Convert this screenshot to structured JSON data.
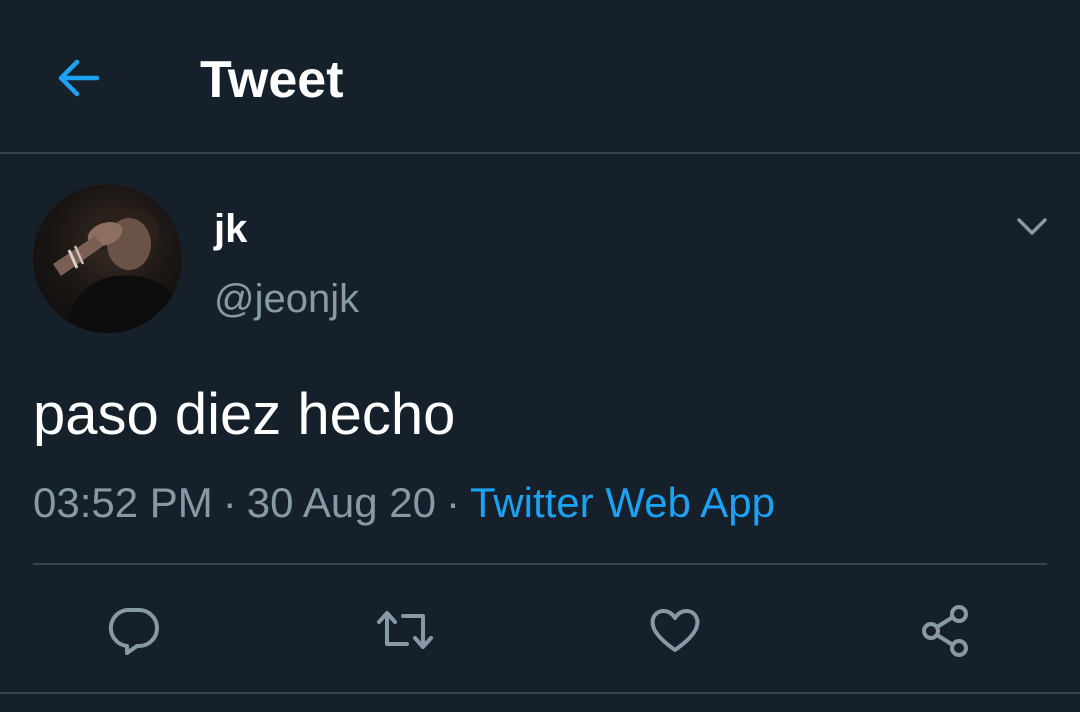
{
  "header": {
    "title": "Tweet",
    "back_icon": "arrow-left-icon"
  },
  "tweet": {
    "display_name": "jk",
    "handle": "@jeonjk",
    "text": "paso diez hecho",
    "time": "03:52 PM",
    "date": "30 Aug 20",
    "separator": "·",
    "source": "Twitter Web App"
  },
  "actions": [
    {
      "name": "reply",
      "icon": "reply-icon"
    },
    {
      "name": "retweet",
      "icon": "retweet-icon"
    },
    {
      "name": "like",
      "icon": "heart-icon"
    },
    {
      "name": "share",
      "icon": "share-icon"
    }
  ],
  "colors": {
    "background": "#15202b",
    "accent": "#1da1f2",
    "secondary_text": "#8899a6",
    "divider": "#38444d",
    "icon": "#8899a6"
  }
}
